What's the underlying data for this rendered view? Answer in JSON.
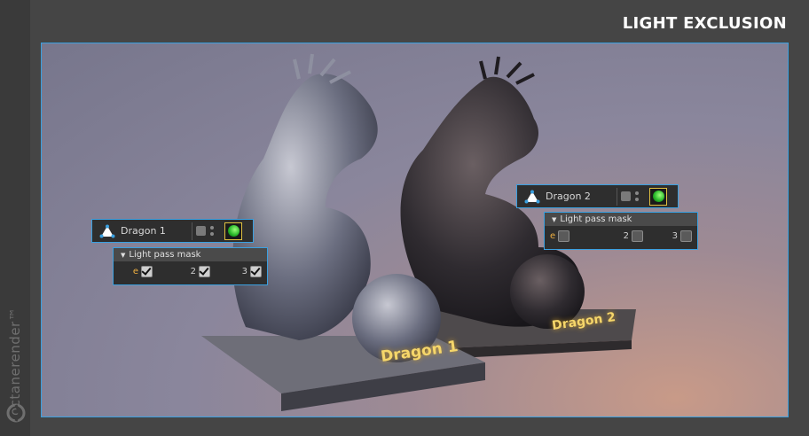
{
  "header": {
    "title": "LIGHT EXCLUSION"
  },
  "brand": {
    "name": "octanerender™"
  },
  "scene": {
    "plate1": "Dragon 1",
    "plate2": "Dragon 2"
  },
  "nodes": [
    {
      "name": "Dragon 1",
      "mask_title": "Light pass mask",
      "mask": [
        {
          "label": "e",
          "checked": true
        },
        {
          "label": "2",
          "checked": true
        },
        {
          "label": "3",
          "checked": true
        }
      ]
    },
    {
      "name": "Dragon 2",
      "mask_title": "Light pass mask",
      "mask": [
        {
          "label": "e",
          "checked": false
        },
        {
          "label": "2",
          "checked": false
        },
        {
          "label": "3",
          "checked": false
        }
      ]
    }
  ],
  "colors": {
    "accent": "#3aa0e0",
    "env_label": "#f0b040",
    "tag_border": "#e0c040"
  },
  "icons": {
    "object": "triangle-object-icon",
    "tag": "octane-object-tag-icon"
  }
}
